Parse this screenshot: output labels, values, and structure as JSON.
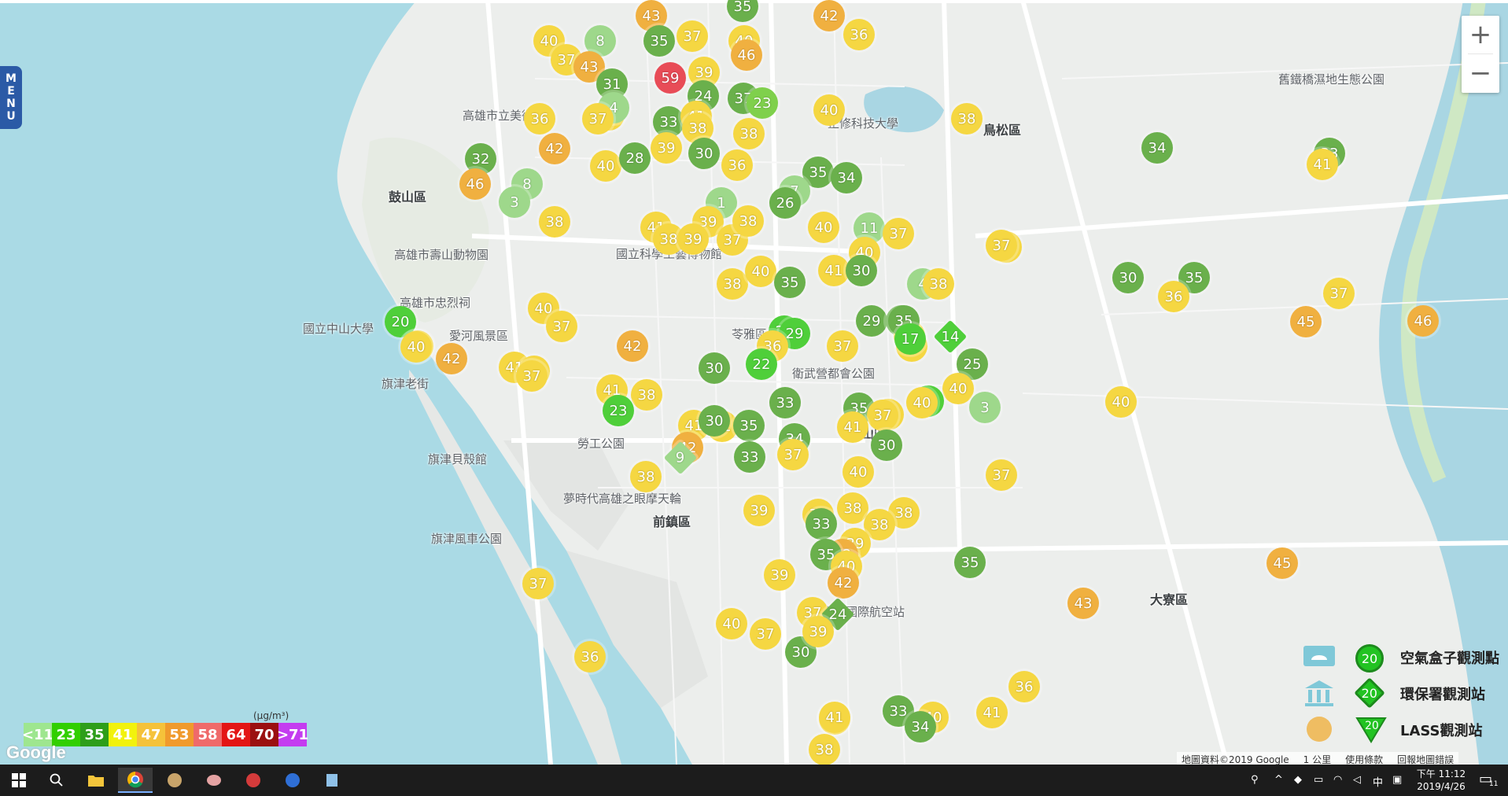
{
  "menu": {
    "label_chars": [
      "M",
      "E",
      "N",
      "U"
    ]
  },
  "zoom": {
    "in_label": "+",
    "out_label": "−"
  },
  "places": [
    {
      "name": "鼓山區",
      "big": true
    },
    {
      "name": "高雄市壽山動物園",
      "big": false
    },
    {
      "name": "高雄市忠烈祠",
      "big": false
    },
    {
      "name": "愛河風景區",
      "big": false
    },
    {
      "name": "旗津老街",
      "big": false
    },
    {
      "name": "旗津貝殼館",
      "big": false
    },
    {
      "name": "旗津風車公園",
      "big": false
    },
    {
      "name": "勞工公園",
      "big": false
    },
    {
      "name": "夢時代高雄之眼摩天輪",
      "big": false
    },
    {
      "name": "前鎮區",
      "big": true
    },
    {
      "name": "國立科學工藝博物館",
      "big": false
    },
    {
      "name": "正修科技大學",
      "big": false
    },
    {
      "name": "鳥松區",
      "big": true
    },
    {
      "name": "衛武營都會公園",
      "big": false
    },
    {
      "name": "鳳山區",
      "big": true
    },
    {
      "name": "高雄國際航空站",
      "big": false
    },
    {
      "name": "大寮區",
      "big": true
    },
    {
      "name": "舊鐵橋濕地生態公園",
      "big": false
    },
    {
      "name": "苓雅區",
      "big": false
    },
    {
      "name": "高雄市立美術館",
      "big": false
    },
    {
      "name": "國立中山大學",
      "big": false
    }
  ],
  "markers": [
    {
      "v": "43",
      "c": "#f0b040",
      "s": "c"
    },
    {
      "v": "35",
      "c": "#6ab04c",
      "s": "c"
    },
    {
      "v": "42",
      "c": "#f0b040",
      "s": "c"
    },
    {
      "v": "36",
      "c": "#f5d742",
      "s": "c"
    },
    {
      "v": "40",
      "c": "#f5d742",
      "s": "c"
    },
    {
      "v": "8",
      "c": "#9ed88b",
      "s": "c"
    },
    {
      "v": "35",
      "c": "#6ab04c",
      "s": "c"
    },
    {
      "v": "37",
      "c": "#f5d742",
      "s": "c"
    },
    {
      "v": "40",
      "c": "#f5d742",
      "s": "c"
    },
    {
      "v": "46",
      "c": "#f0b040",
      "s": "c"
    },
    {
      "v": "37",
      "c": "#f5d742",
      "s": "c"
    },
    {
      "v": "43",
      "c": "#f0b040",
      "s": "c"
    },
    {
      "v": "59",
      "c": "#e84c57",
      "s": "c"
    },
    {
      "v": "39",
      "c": "#f5d742",
      "s": "c"
    },
    {
      "v": "31",
      "c": "#6ab04c",
      "s": "c"
    },
    {
      "v": "24",
      "c": "#6ab04c",
      "s": "c"
    },
    {
      "v": "37",
      "c": "#6ab04c",
      "s": "c"
    },
    {
      "v": "23",
      "c": "#7fd04c",
      "s": "c"
    },
    {
      "v": "40",
      "c": "#f5d742",
      "s": "c"
    },
    {
      "v": "4",
      "c": "#9ed88b",
      "s": "c"
    },
    {
      "v": "36",
      "c": "#f5d742",
      "s": "c"
    },
    {
      "v": "37",
      "c": "#f5d742",
      "s": "c"
    },
    {
      "v": "33",
      "c": "#6ab04c",
      "s": "c"
    },
    {
      "v": "41",
      "c": "#f5d742",
      "s": "c"
    },
    {
      "v": "38",
      "c": "#f5d742",
      "s": "c"
    },
    {
      "v": "38",
      "c": "#f5d742",
      "s": "c"
    },
    {
      "v": "32",
      "c": "#6ab04c",
      "s": "c"
    },
    {
      "v": "42",
      "c": "#f0b040",
      "s": "c"
    },
    {
      "v": "40",
      "c": "#f5d742",
      "s": "c"
    },
    {
      "v": "28",
      "c": "#6ab04c",
      "s": "c"
    },
    {
      "v": "39",
      "c": "#f5d742",
      "s": "c"
    },
    {
      "v": "30",
      "c": "#6ab04c",
      "s": "c"
    },
    {
      "v": "36",
      "c": "#f5d742",
      "s": "c"
    },
    {
      "v": "35",
      "c": "#6ab04c",
      "s": "c"
    },
    {
      "v": "34",
      "c": "#6ab04c",
      "s": "c"
    },
    {
      "v": "40",
      "c": "#f5d742",
      "s": "c"
    },
    {
      "v": "38",
      "c": "#f5d742",
      "s": "c"
    },
    {
      "v": "34",
      "c": "#6ab04c",
      "s": "c"
    },
    {
      "v": "33",
      "c": "#6ab04c",
      "s": "c"
    },
    {
      "v": "41",
      "c": "#f5d742",
      "s": "c"
    },
    {
      "v": "46",
      "c": "#f0b040",
      "s": "c"
    },
    {
      "v": "8",
      "c": "#9ed88b",
      "s": "c"
    },
    {
      "v": "3",
      "c": "#9ed88b",
      "s": "c"
    },
    {
      "v": "38",
      "c": "#f5d742",
      "s": "c"
    },
    {
      "v": "1",
      "c": "#9ed88b",
      "s": "c"
    },
    {
      "v": "7",
      "c": "#9ed88b",
      "s": "c"
    },
    {
      "v": "26",
      "c": "#6ab04c",
      "s": "c"
    },
    {
      "v": "41",
      "c": "#f5d742",
      "s": "c"
    },
    {
      "v": "39",
      "c": "#f5d742",
      "s": "c"
    },
    {
      "v": "38",
      "c": "#f5d742",
      "s": "c"
    },
    {
      "v": "39",
      "c": "#f5d742",
      "s": "c"
    },
    {
      "v": "37",
      "c": "#f5d742",
      "s": "c"
    },
    {
      "v": "38",
      "c": "#f5d742",
      "s": "c"
    },
    {
      "v": "40",
      "c": "#f5d742",
      "s": "c"
    },
    {
      "v": "11",
      "c": "#9ed88b",
      "s": "c"
    },
    {
      "v": "37",
      "c": "#f5d742",
      "s": "c"
    },
    {
      "v": "40",
      "c": "#f5d742",
      "s": "c"
    },
    {
      "v": "41",
      "c": "#f5d742",
      "s": "c"
    },
    {
      "v": "37",
      "c": "#f5d742",
      "s": "c"
    },
    {
      "v": "41",
      "c": "#f5d742",
      "s": "c"
    },
    {
      "v": "38",
      "c": "#f5d742",
      "s": "c"
    },
    {
      "v": "40",
      "c": "#f5d742",
      "s": "c"
    },
    {
      "v": "35",
      "c": "#6ab04c",
      "s": "c"
    },
    {
      "v": "30",
      "c": "#6ab04c",
      "s": "c"
    },
    {
      "v": "4",
      "c": "#9ed88b",
      "s": "c"
    },
    {
      "v": "38",
      "c": "#f5d742",
      "s": "c"
    },
    {
      "v": "30",
      "c": "#6ab04c",
      "s": "c"
    },
    {
      "v": "35",
      "c": "#6ab04c",
      "s": "c"
    },
    {
      "v": "36",
      "c": "#f5d742",
      "s": "c"
    },
    {
      "v": "37",
      "c": "#f5d742",
      "s": "c"
    },
    {
      "v": "40",
      "c": "#f5d742",
      "s": "c"
    },
    {
      "v": "37",
      "c": "#f5d742",
      "s": "c"
    },
    {
      "v": "29",
      "c": "#6ab04c",
      "s": "c"
    },
    {
      "v": "26",
      "c": "#6ab04c",
      "s": "c"
    },
    {
      "v": "46",
      "c": "#f0b040",
      "s": "c"
    },
    {
      "v": "30",
      "c": "#6ab04c",
      "s": "c"
    },
    {
      "v": "23",
      "c": "#4fcf3a",
      "s": "c"
    },
    {
      "v": "29",
      "c": "#4fcf3a",
      "s": "c"
    },
    {
      "v": "37",
      "c": "#f5d742",
      "s": "c"
    },
    {
      "v": "35",
      "c": "#6ab04c",
      "s": "c"
    },
    {
      "v": "14",
      "c": "#4fcf3a",
      "s": "d"
    },
    {
      "v": "45",
      "c": "#f0b040",
      "s": "c"
    },
    {
      "v": "20",
      "c": "#4fcf3a",
      "s": "c"
    },
    {
      "v": "36",
      "c": "#f5d742",
      "s": "c"
    },
    {
      "v": "40",
      "c": "#f5d742",
      "s": "c"
    },
    {
      "v": "42",
      "c": "#f0b040",
      "s": "c"
    },
    {
      "v": "37",
      "c": "#f5d742",
      "s": "c"
    },
    {
      "v": "38",
      "c": "#f5d742",
      "s": "c"
    },
    {
      "v": "17",
      "c": "#4fcf3a",
      "s": "c"
    },
    {
      "v": "36",
      "c": "#f5d742",
      "s": "c"
    },
    {
      "v": "22",
      "c": "#4fcf3a",
      "s": "c"
    },
    {
      "v": "25",
      "c": "#6ab04c",
      "s": "c"
    },
    {
      "v": "42",
      "c": "#f0b040",
      "s": "c"
    },
    {
      "v": "41",
      "c": "#f5d742",
      "s": "c"
    },
    {
      "v": "36",
      "c": "#f5d742",
      "s": "c"
    },
    {
      "v": "37",
      "c": "#f5d742",
      "s": "c"
    },
    {
      "v": "40",
      "c": "#f5d742",
      "s": "c"
    },
    {
      "v": "20",
      "c": "#4fcf3a",
      "s": "c"
    },
    {
      "v": "41",
      "c": "#f5d742",
      "s": "c"
    },
    {
      "v": "38",
      "c": "#f5d742",
      "s": "c"
    },
    {
      "v": "23",
      "c": "#4fcf3a",
      "s": "c"
    },
    {
      "v": "33",
      "c": "#6ab04c",
      "s": "c"
    },
    {
      "v": "35",
      "c": "#6ab04c",
      "s": "c"
    },
    {
      "v": "40",
      "c": "#f5d742",
      "s": "c"
    },
    {
      "v": "40",
      "c": "#f5d742",
      "s": "c"
    },
    {
      "v": "3",
      "c": "#9ed88b",
      "s": "c"
    },
    {
      "v": "40",
      "c": "#f5d742",
      "s": "c"
    },
    {
      "v": "41",
      "c": "#f5d742",
      "s": "c"
    },
    {
      "v": "41",
      "c": "#f5d742",
      "s": "c"
    },
    {
      "v": "30",
      "c": "#6ab04c",
      "s": "c"
    },
    {
      "v": "35",
      "c": "#6ab04c",
      "s": "c"
    },
    {
      "v": "34",
      "c": "#6ab04c",
      "s": "c"
    },
    {
      "v": "37",
      "c": "#f5d742",
      "s": "c"
    },
    {
      "v": "41",
      "c": "#f5d742",
      "s": "c"
    },
    {
      "v": "30",
      "c": "#6ab04c",
      "s": "c"
    },
    {
      "v": "33",
      "c": "#6ab04c",
      "s": "c"
    },
    {
      "v": "42",
      "c": "#f0b040",
      "s": "c"
    },
    {
      "v": "9",
      "c": "#9ed88b",
      "s": "d"
    },
    {
      "v": "38",
      "c": "#f5d742",
      "s": "c"
    },
    {
      "v": "37",
      "c": "#f5d742",
      "s": "c"
    },
    {
      "v": "37",
      "c": "#f5d742",
      "s": "c"
    },
    {
      "v": "40",
      "c": "#f5d742",
      "s": "c"
    },
    {
      "v": "38",
      "c": "#f5d742",
      "s": "c"
    },
    {
      "v": "39",
      "c": "#f5d742",
      "s": "c"
    },
    {
      "v": "39",
      "c": "#f5d742",
      "s": "c"
    },
    {
      "v": "33",
      "c": "#6ab04c",
      "s": "c"
    },
    {
      "v": "38",
      "c": "#f5d742",
      "s": "c"
    },
    {
      "v": "38",
      "c": "#f5d742",
      "s": "c"
    },
    {
      "v": "39",
      "c": "#f5d742",
      "s": "c"
    },
    {
      "v": "42",
      "c": "#f0b040",
      "s": "c"
    },
    {
      "v": "35",
      "c": "#6ab04c",
      "s": "c"
    },
    {
      "v": "40",
      "c": "#f5d742",
      "s": "c"
    },
    {
      "v": "39",
      "c": "#f5d742",
      "s": "c"
    },
    {
      "v": "37",
      "c": "#f5d742",
      "s": "c"
    },
    {
      "v": "37",
      "c": "#f5d742",
      "s": "c"
    },
    {
      "v": "35",
      "c": "#6ab04c",
      "s": "c"
    },
    {
      "v": "43",
      "c": "#f0b040",
      "s": "c"
    },
    {
      "v": "45",
      "c": "#f0b040",
      "s": "c"
    },
    {
      "v": "36",
      "c": "#f5d742",
      "s": "c"
    },
    {
      "v": "30",
      "c": "#6ab04c",
      "s": "c"
    },
    {
      "v": "42",
      "c": "#f0b040",
      "s": "c"
    },
    {
      "v": "24",
      "c": "#6ab04c",
      "s": "d"
    },
    {
      "v": "39",
      "c": "#f5d742",
      "s": "c"
    },
    {
      "v": "40",
      "c": "#f5d742",
      "s": "c"
    },
    {
      "v": "37",
      "c": "#f5d742",
      "s": "c"
    },
    {
      "v": "40",
      "c": "#f5d742",
      "s": "c"
    },
    {
      "v": "36",
      "c": "#f5d742",
      "s": "c"
    },
    {
      "v": "41",
      "c": "#f5d742",
      "s": "c"
    },
    {
      "v": "33",
      "c": "#6ab04c",
      "s": "c"
    },
    {
      "v": "40",
      "c": "#f5d742",
      "s": "c"
    },
    {
      "v": "34",
      "c": "#6ab04c",
      "s": "c"
    },
    {
      "v": "41",
      "c": "#f5d742",
      "s": "c"
    },
    {
      "v": "38",
      "c": "#f5d742",
      "s": "c"
    }
  ],
  "scale": {
    "unit": "(μg/m³)",
    "cells": [
      {
        "label": "<11",
        "color": "#9ee68f"
      },
      {
        "label": "23",
        "color": "#31cf00"
      },
      {
        "label": "35",
        "color": "#2e9e1a"
      },
      {
        "label": "41",
        "color": "#f2f20c"
      },
      {
        "label": "47",
        "color": "#f5c23a"
      },
      {
        "label": "53",
        "color": "#f09a2c"
      },
      {
        "label": "58",
        "color": "#ef6a6a"
      },
      {
        "label": "64",
        "color": "#e31515"
      },
      {
        "label": "70",
        "color": "#9b1010"
      },
      {
        "label": ">71",
        "color": "#c43cf0"
      }
    ]
  },
  "google_logo": "Google",
  "type_legend": {
    "items": [
      {
        "label": "空氣盒子觀測點",
        "value": "20",
        "shape": "circle"
      },
      {
        "label": "環保署觀測站",
        "value": "20",
        "shape": "diamond"
      },
      {
        "label": "LASS觀測站",
        "value": "20",
        "shape": "triangle"
      }
    ]
  },
  "attribution": {
    "map_data": "地圖資料©2019 Google",
    "scale_text": "1 公里",
    "terms": "使用條款",
    "report": "回報地圖錯誤"
  },
  "taskbar": {
    "time": "下午 11:12",
    "date": "2019/4/26",
    "ime": "中",
    "notif_count": "11"
  }
}
